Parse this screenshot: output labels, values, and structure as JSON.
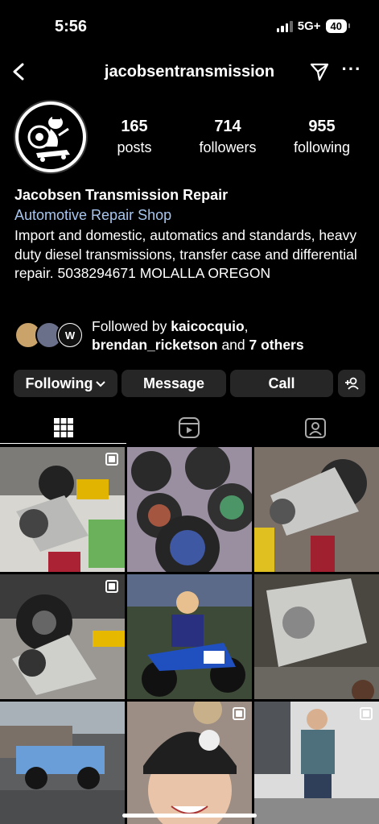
{
  "status_bar": {
    "time": "5:56",
    "network": "5G+",
    "battery": "40"
  },
  "header": {
    "username": "jacobsentransmission",
    "more": "···"
  },
  "stats": [
    {
      "value": "165",
      "label": "posts"
    },
    {
      "value": "714",
      "label": "followers"
    },
    {
      "value": "955",
      "label": "following"
    }
  ],
  "bio": {
    "name": "Jacobsen Transmission Repair",
    "category": "Automotive Repair Shop",
    "text": "Import and domestic, automatics and standards, heavy duty diesel transmissions, transfer case and differential repair. 5038294671 MOLALLA OREGON"
  },
  "followed_by": {
    "prefix": "Followed by ",
    "user1": "kaicocquio",
    "sep": ", ",
    "user2": "brendan_ricketson",
    "and": " and ",
    "others": "7 others"
  },
  "buttons": {
    "following": "Following",
    "message": "Message",
    "call": "Call"
  },
  "tabs": [
    "grid-tab",
    "reels-tab",
    "tagged-tab"
  ],
  "posts": [
    {
      "subject": "transmission-under-truck",
      "bg": "#6b6a66",
      "multi": true
    },
    {
      "subject": "holographic-stickers",
      "bg": "#8a7a8c",
      "multi": false
    },
    {
      "subject": "transmission-on-jack",
      "bg": "#6e665c",
      "multi": false
    },
    {
      "subject": "transmission-lifted-truck",
      "bg": "#5a5a5a",
      "multi": true
    },
    {
      "subject": "kid-on-dirt-bike",
      "bg": "#3f4a3c",
      "multi": false
    },
    {
      "subject": "transmission-on-bench",
      "bg": "#7a7670",
      "multi": false
    },
    {
      "subject": "blue-bronco",
      "bg": "#5b6670",
      "multi": false
    },
    {
      "subject": "child-in-beanie",
      "bg": "#8a6a52",
      "multi": true
    },
    {
      "subject": "man-thumbs-up-van",
      "bg": "#8e8f92",
      "multi": true
    }
  ]
}
